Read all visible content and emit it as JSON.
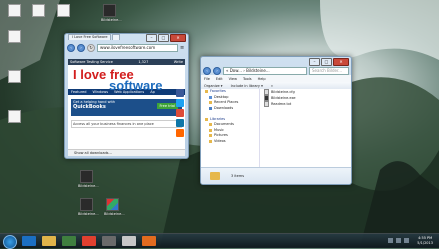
{
  "desktop": {
    "icons": [
      {
        "label": ""
      },
      {
        "label": ""
      },
      {
        "label": ""
      },
      {
        "label": ""
      },
      {
        "label": ""
      },
      {
        "label": ""
      },
      {
        "label": "Bildsteine..."
      },
      {
        "label": "Bildsteine..."
      },
      {
        "label": "Bildsteine..."
      },
      {
        "label": "Bildsteine..."
      }
    ]
  },
  "browser": {
    "title": "I Love Free Software",
    "address": "www.ilovefreesoftware.com",
    "tab1": "I Love Free Software",
    "tab2": "",
    "bar_left": "Software Testing Service",
    "bar_count": "1,327",
    "bar_right": "Write",
    "logo_free": "I love free",
    "logo_software": "software",
    "nav": [
      "Featured",
      "Windows",
      "Web Applications",
      "Ap"
    ],
    "ad_line1": "Get a helping hand with",
    "ad_brand": "QuickBooks",
    "ad_cta": "Free trial",
    "ad_line2": "Access all your business finances in one place",
    "status": "Show all downloads..."
  },
  "explorer": {
    "address": "« Dow... › Bildsteine...",
    "search_placeholder": "Search Bilder...",
    "menu": [
      "File",
      "Edit",
      "View",
      "Tools",
      "Help"
    ],
    "commands": [
      "Organize ▾",
      "Include in library ▾",
      "»"
    ],
    "nav_items": [
      {
        "label": "Favorites",
        "header": true
      },
      {
        "label": "Desktop",
        "header": false
      },
      {
        "label": "Recent Places",
        "header": false
      },
      {
        "label": "Downloads",
        "header": false
      },
      {
        "label": "",
        "header": false
      },
      {
        "label": "Libraries",
        "header": true
      },
      {
        "label": "Documents",
        "header": false
      },
      {
        "label": "Music",
        "header": false
      },
      {
        "label": "Pictures",
        "header": false
      },
      {
        "label": "Videos",
        "header": false
      }
    ],
    "files": [
      "Bildsteine.cfg",
      "Bildsteine.exe",
      "Readme.txt"
    ],
    "item_count": "3 items"
  },
  "taskbar": {
    "time": "4:55 PM",
    "date": "5/1/2013"
  }
}
